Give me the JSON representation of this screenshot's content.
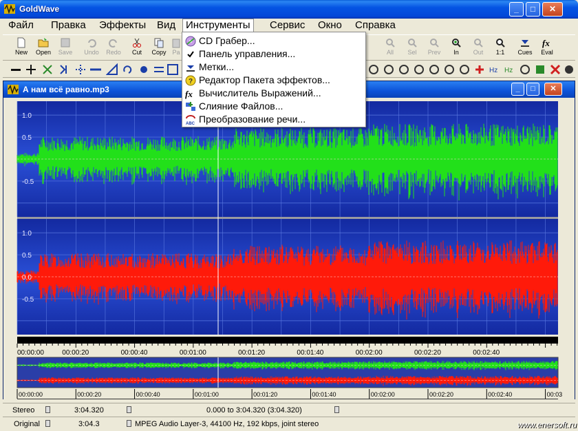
{
  "app": {
    "title": "GoldWave"
  },
  "menu": [
    "Файл",
    "Правка",
    "Эффекты",
    "Вид",
    "Инструменты",
    "Сервис",
    "Окно",
    "Справка"
  ],
  "toolbar": {
    "left": [
      {
        "label": "New",
        "enabled": true
      },
      {
        "label": "Open",
        "enabled": true
      },
      {
        "label": "Save",
        "enabled": false
      },
      {
        "label": "Undo",
        "enabled": false
      },
      {
        "label": "Redo",
        "enabled": false
      },
      {
        "label": "Cut",
        "enabled": true
      },
      {
        "label": "Copy",
        "enabled": true
      },
      {
        "label": "Pa",
        "enabled": false
      }
    ],
    "right": [
      {
        "label": "All",
        "enabled": false
      },
      {
        "label": "Sel",
        "enabled": false
      },
      {
        "label": "Prev",
        "enabled": false
      },
      {
        "label": "In",
        "enabled": true
      },
      {
        "label": "Out",
        "enabled": false
      },
      {
        "label": "1:1",
        "enabled": true
      },
      {
        "label": "Cues",
        "enabled": true
      },
      {
        "label": "Eval",
        "enabled": true
      }
    ]
  },
  "tools_menu": {
    "items": [
      {
        "label": "CD Грабер...",
        "icon": "cd-icon",
        "checked": false
      },
      {
        "label": "Панель управления...",
        "icon": "check-icon",
        "checked": true
      },
      {
        "label": "Метки...",
        "icon": "marker-icon",
        "checked": false
      },
      {
        "label": "Редактор Пакета эффектов...",
        "icon": "batch-icon",
        "checked": false
      },
      {
        "label": "Вычислитель Выражений...",
        "icon": "fx-icon",
        "checked": false
      },
      {
        "label": "Слияние Файлов...",
        "icon": "merge-icon",
        "checked": false
      },
      {
        "label": "Преобразование речи...",
        "icon": "speech-icon",
        "checked": false
      }
    ]
  },
  "document": {
    "title": "А нам всё равно.mp3",
    "y_labels_top": [
      "1.0",
      "0.5",
      "",
      "-0.5"
    ],
    "y_labels_bottom": [
      "1.0",
      "0.5",
      "0.0",
      "-0.5"
    ],
    "time_labels": [
      "00:00:00",
      "00:00:20",
      "00:00:40",
      "00:01:00",
      "00:01:20",
      "00:01:40",
      "00:02:00",
      "00:02:20",
      "00:02:40"
    ],
    "overview_labels": [
      "00:00:00",
      "00:00:20",
      "00:00:40",
      "00:01:00",
      "00:01:20",
      "00:01:40",
      "00:02:00",
      "00:02:20",
      "00:02:40",
      "00:03"
    ],
    "colors": {
      "left_channel": "#22e01a",
      "right_channel": "#ff1a0a",
      "background": "#1a2da8"
    }
  },
  "status": {
    "row1": {
      "channels": "Stereo",
      "length": "3:04.320",
      "selection": "0.000 to 3:04.320 (3:04.320)"
    },
    "row2": {
      "mode": "Original",
      "length": "3:04.3",
      "format": "MPEG Audio Layer-3, 44100 Hz, 192 kbps, joint stereo"
    }
  },
  "watermark": "www.enersoft.ru"
}
